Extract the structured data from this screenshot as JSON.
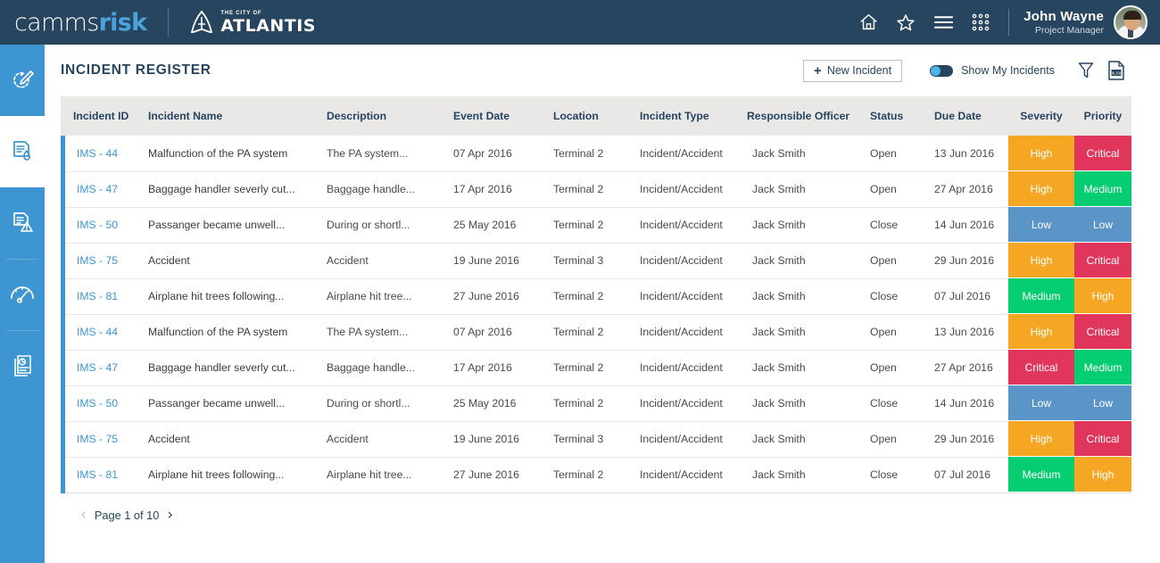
{
  "header": {
    "logo_primary": "camms",
    "logo_secondary": "risk",
    "org_small": "THE CITY OF",
    "org_name": "ATLANTIS",
    "icons": [
      "home-icon",
      "star-icon",
      "menu-icon",
      "apps-grid-icon"
    ],
    "user_name": "John Wayne",
    "user_role": "Project Manager"
  },
  "sidebar": {
    "items": [
      {
        "name": "sidebar-item-review-edit",
        "icon": "refresh-pencil-icon",
        "active": false
      },
      {
        "name": "sidebar-item-risk-register",
        "icon": "document-flame-icon",
        "active": true
      },
      {
        "name": "sidebar-item-incident-register",
        "icon": "document-warning-icon",
        "active": false
      },
      {
        "name": "sidebar-item-performance",
        "icon": "gauge-icon",
        "active": false
      },
      {
        "name": "sidebar-item-reports",
        "icon": "report-pages-icon",
        "active": false
      }
    ]
  },
  "page": {
    "title": "INCIDENT REGISTER",
    "new_incident_label": "New Incident",
    "new_incident_plus": "+",
    "show_my_incidents_label": "Show My Incidents",
    "show_my_incidents_on": false,
    "filter_icon": "funnel-filter-icon",
    "export_icon": "xlsx-export-icon",
    "export_icon_label": "XLSX"
  },
  "table": {
    "columns": [
      "Incident ID",
      "Incident Name",
      "Description",
      "Event Date",
      "Location",
      "Incident Type",
      "Responsible Officer",
      "Status",
      "Due Date",
      "Severity",
      "Priority"
    ],
    "rows": [
      {
        "id": "IMS - 44",
        "name": "Malfunction of the PA system",
        "description": "The PA system...",
        "event_date": "07 Apr 2016",
        "location": "Terminal 2",
        "type": "Incident/Accident",
        "officer": "Jack Smith",
        "status": "Open",
        "due_date": "13 Jun 2016",
        "severity": "High",
        "priority": "Critical"
      },
      {
        "id": "IMS - 47",
        "name": "Baggage handler severly cut...",
        "description": "Baggage handle...",
        "event_date": "17 Apr 2016",
        "location": "Terminal 2",
        "type": "Incident/Accident",
        "officer": "Jack Smith",
        "status": "Open",
        "due_date": "27 Apr 2016",
        "severity": "High",
        "priority": "Medium"
      },
      {
        "id": "IMS - 50",
        "name": "Passanger became unwell...",
        "description": "During or shortl...",
        "event_date": "25 May 2016",
        "location": "Terminal 2",
        "type": "Incident/Accident",
        "officer": "Jack Smith",
        "status": "Close",
        "due_date": "14 Jun 2016",
        "severity": "Low",
        "priority": "Low"
      },
      {
        "id": "IMS - 75",
        "name": "Accident",
        "description": "Accident",
        "event_date": "19 June 2016",
        "location": "Terminal 3",
        "type": "Incident/Accident",
        "officer": "Jack Smith",
        "status": "Open",
        "due_date": "29 Jun 2016",
        "severity": "High",
        "priority": "Critical"
      },
      {
        "id": "IMS - 81",
        "name": "Airplane hit trees following...",
        "description": "Airplane hit tree...",
        "event_date": "27 June 2016",
        "location": "Terminal 2",
        "type": "Incident/Accident",
        "officer": "Jack Smith",
        "status": "Close",
        "due_date": "07 Jul 2016",
        "severity": "Medium",
        "priority": "High"
      },
      {
        "id": "IMS - 44",
        "name": "Malfunction of the PA system",
        "description": "The PA system...",
        "event_date": "07 Apr 2016",
        "location": "Terminal 2",
        "type": "Incident/Accident",
        "officer": "Jack Smith",
        "status": "Open",
        "due_date": "13 Jun 2016",
        "severity": "High",
        "priority": "Critical"
      },
      {
        "id": "IMS - 47",
        "name": "Baggage handler severly cut...",
        "description": "Baggage handle...",
        "event_date": "17 Apr 2016",
        "location": "Terminal 2",
        "type": "Incident/Accident",
        "officer": "Jack Smith",
        "status": "Open",
        "due_date": "27 Apr 2016",
        "severity": "Critical",
        "priority": "Medium"
      },
      {
        "id": "IMS - 50",
        "name": "Passanger became unwell...",
        "description": "During or shortl...",
        "event_date": "25 May 2016",
        "location": "Terminal 2",
        "type": "Incident/Accident",
        "officer": "Jack Smith",
        "status": "Close",
        "due_date": "14 Jun 2016",
        "severity": "Low",
        "priority": "Low"
      },
      {
        "id": "IMS - 75",
        "name": "Accident",
        "description": "Accident",
        "event_date": "19 June 2016",
        "location": "Terminal 3",
        "type": "Incident/Accident",
        "officer": "Jack Smith",
        "status": "Open",
        "due_date": "29 Jun 2016",
        "severity": "High",
        "priority": "Critical"
      },
      {
        "id": "IMS - 81",
        "name": "Airplane hit trees following...",
        "description": "Airplane hit tree...",
        "event_date": "27 June 2016",
        "location": "Terminal 2",
        "type": "Incident/Accident",
        "officer": "Jack Smith",
        "status": "Close",
        "due_date": "07 Jul 2016",
        "severity": "Medium",
        "priority": "High"
      }
    ]
  },
  "pagination": {
    "prev_arrow": "‹",
    "next_arrow": "›",
    "label": "Page 1 of 10",
    "current_page": 1,
    "total_pages": 10,
    "prev_enabled": false,
    "next_enabled": true
  },
  "colors": {
    "header_bg": "#27455f",
    "sidebar_bg": "#3d95d1",
    "accent_blue": "#3d95d1",
    "table_header_bg": "#eae7e7",
    "severity_high": "#f5a623",
    "severity_critical": "#e0365b",
    "severity_medium": "#06cc72",
    "severity_low": "#5b94c6"
  }
}
